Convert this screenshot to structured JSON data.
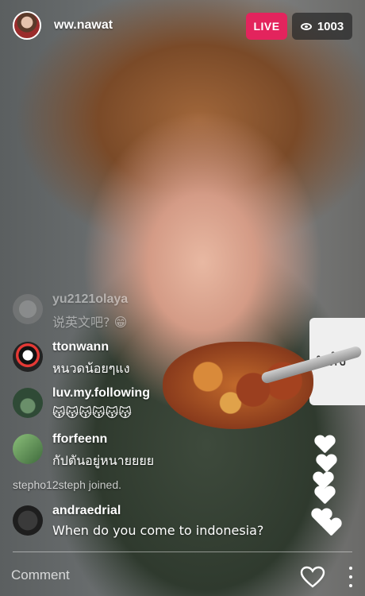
{
  "header": {
    "username": "ww.nawat",
    "live_label": "LIVE",
    "viewer_count": "1003"
  },
  "scene": {
    "sign_text": "มลัง"
  },
  "comments": [
    {
      "user": "yu2121olaya",
      "text": "说英文吧? 😁"
    },
    {
      "user": "ttonwann",
      "text": "หนวดน้อยๆแง"
    },
    {
      "user": "luv.my.following",
      "text": "😽😽😽😽😽😽"
    },
    {
      "user": "fforfeenn",
      "text": "กัปตันอยู่หนายยยย"
    },
    {
      "user": "andraedrial",
      "text": "When do you come to indonesia?"
    }
  ],
  "system_message": "stepho12steph joined.",
  "composer": {
    "placeholder": "Comment"
  },
  "colors": {
    "live": "#e3245d"
  }
}
